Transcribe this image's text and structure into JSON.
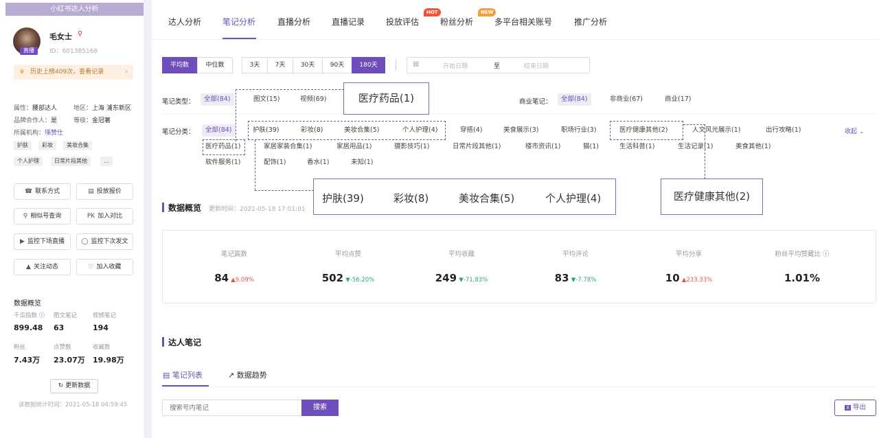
{
  "sidebar": {
    "header": "小红书达人分析",
    "live_badge": "直播",
    "name": "毛女士",
    "name_icon": "pin-icon",
    "id": "ID：601385168",
    "history": "历史上榜409次，查看记录",
    "attrs": {
      "type_label": "属性：",
      "type_value": "腰部达人",
      "region_label": "地区：",
      "region_value": "上海 浦东新区",
      "brand_label": "品牌合作人：",
      "brand_value": "是",
      "level_label": "等级：",
      "level_value": "金冠薯",
      "org_label": "所属机构：",
      "org_value": "㙣赞仕"
    },
    "tags": [
      "护肤",
      "彩妆",
      "美妆合集",
      "个人护理",
      "日常片段其他",
      "..."
    ],
    "buttons": [
      "联系方式",
      "投放报价",
      "相似号查询",
      "加入对比",
      "监控下场直播",
      "监控下次发文",
      "关注动态",
      "加入收藏"
    ],
    "button_icons": [
      "phone-icon",
      "tag-icon",
      "search-icon",
      "pk-icon",
      "video-icon",
      "bell-icon",
      "chart-icon",
      "heart-icon"
    ],
    "pk_prefix": "PK",
    "overview_title": "数据概览",
    "stats": [
      {
        "label": "千瓜指数",
        "value": "899.48"
      },
      {
        "label": "图文笔记",
        "value": "63"
      },
      {
        "label": "视频笔记",
        "value": "194"
      },
      {
        "label": "粉丝",
        "value": "7.43万"
      },
      {
        "label": "点赞数",
        "value": "23.07万"
      },
      {
        "label": "收藏数",
        "value": "19.98万"
      }
    ],
    "refresh": "更新数据",
    "stat_time": "该数据统计时间：2021-05-18 04:59:45"
  },
  "nav": {
    "tabs": [
      "达人分析",
      "笔记分析",
      "直播分析",
      "直播记录",
      "投放评估",
      "粉丝分析",
      "多平台相关账号",
      "推广分析"
    ],
    "active": "笔记分析",
    "hot": "HOT",
    "new": "NEW"
  },
  "filters": {
    "avg": "平均数",
    "median": "中位数",
    "days": [
      "3天",
      "7天",
      "30天",
      "90天",
      "180天"
    ],
    "start": "开始日期",
    "to": "至",
    "end": "结束日期",
    "note_type_label": "笔记类型：",
    "note_types": [
      "全部(84)",
      "图文(15)",
      "视频(69)"
    ],
    "biz_label": "商业笔记：",
    "biz_types": [
      "全部(84)",
      "非商业(67)",
      "商业(17)"
    ],
    "cat_label": "笔记分类：",
    "cat_row1": [
      "全部(84)",
      "护肤(39)",
      "彩妆(8)",
      "美妆合集(5)",
      "个人护理(4)",
      "穿搭(4)",
      "美食展示(3)",
      "职场行业(3)",
      "医疗健康其他(2)",
      "人文风光展示(1)",
      "出行攻略(1)"
    ],
    "cat_row2": [
      "医疗药品(1)",
      "家居家装合集(1)",
      "家居用品(1)",
      "摄影技巧(1)",
      "日常片段其他(1)",
      "楼市资讯(1)",
      "猫(1)",
      "生活科普(1)",
      "生活记录(1)",
      "美食其他(1)"
    ],
    "cat_row3": [
      "软件服务(1)",
      "配饰(1)",
      "香水(1)",
      "未知(1)"
    ],
    "collapse": "收起"
  },
  "callouts": {
    "medical": "医疗药品(1)",
    "group": [
      "护肤(39)",
      "彩妆(8)",
      "美妆合集(5)",
      "个人护理(4)"
    ],
    "health": "医疗健康其他(2)"
  },
  "overview": {
    "title": "数据概览",
    "time": "更新时间：2021-05-18 17:01:01",
    "metrics": [
      {
        "label": "笔记篇数",
        "value": "84",
        "change": "9.09%",
        "dir": "up"
      },
      {
        "label": "平均点赞",
        "value": "502",
        "change": "-56.20%",
        "dir": "down"
      },
      {
        "label": "平均收藏",
        "value": "249",
        "change": "-71.83%",
        "dir": "down"
      },
      {
        "label": "平均评论",
        "value": "83",
        "change": "-7.78%",
        "dir": "down"
      },
      {
        "label": "平均分享",
        "value": "10",
        "change": "233.33%",
        "dir": "up"
      },
      {
        "label": "粉丝平均赞藏比",
        "value": "1.01%",
        "change": "",
        "dir": ""
      }
    ]
  },
  "notes": {
    "title": "达人笔记",
    "tab_list": "笔记列表",
    "tab_trend": "数据趋势",
    "search_placeholder": "搜索号内笔记",
    "search_btn": "搜索",
    "export": "导出"
  },
  "colors": {
    "accent": "#6f4dba",
    "up": "#e5534b",
    "down": "#2aa86a",
    "hot": "#f0533a",
    "new": "#f2a13a"
  }
}
